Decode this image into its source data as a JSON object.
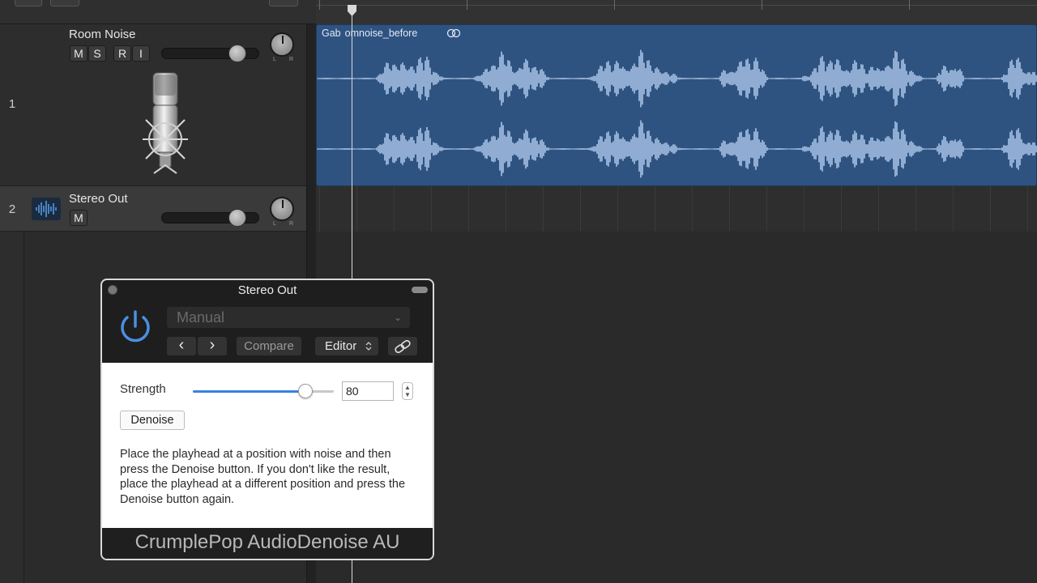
{
  "tracks": [
    {
      "number": "1",
      "name": "Room Noise",
      "buttons": [
        "M",
        "S",
        "R",
        "I"
      ],
      "pan_labels": {
        "left": "L",
        "right": "R"
      },
      "volume_level": 0.85,
      "icon": "condenser-microphone-icon"
    },
    {
      "number": "2",
      "name": "Stereo Out",
      "buttons": [
        "M"
      ],
      "pan_labels": {
        "left": "L",
        "right": "R"
      },
      "volume_level": 0.85,
      "icon": "waveform-icon"
    }
  ],
  "region": {
    "name": "Gab  omnoise_before",
    "color": "#2f5380",
    "waveform_color": "#a9c3e6"
  },
  "plugin": {
    "title": "Stereo Out",
    "preset": "Manual",
    "prev_label": "‹",
    "next_label": "›",
    "compare_label": "Compare",
    "editor_label": "Editor",
    "strength_label": "Strength",
    "strength_value": "80",
    "strength_fraction": 0.8,
    "denoise_label": "Denoise",
    "help_text": "Place the playhead at a position with noise and then press the Denoise button. If you don't like the result, place the playhead at a different position and press the Denoise button again.",
    "footer": "CrumplePop AudioDenoise AU",
    "accent_color": "#3b82e0",
    "power_color": "#4a90e2"
  }
}
